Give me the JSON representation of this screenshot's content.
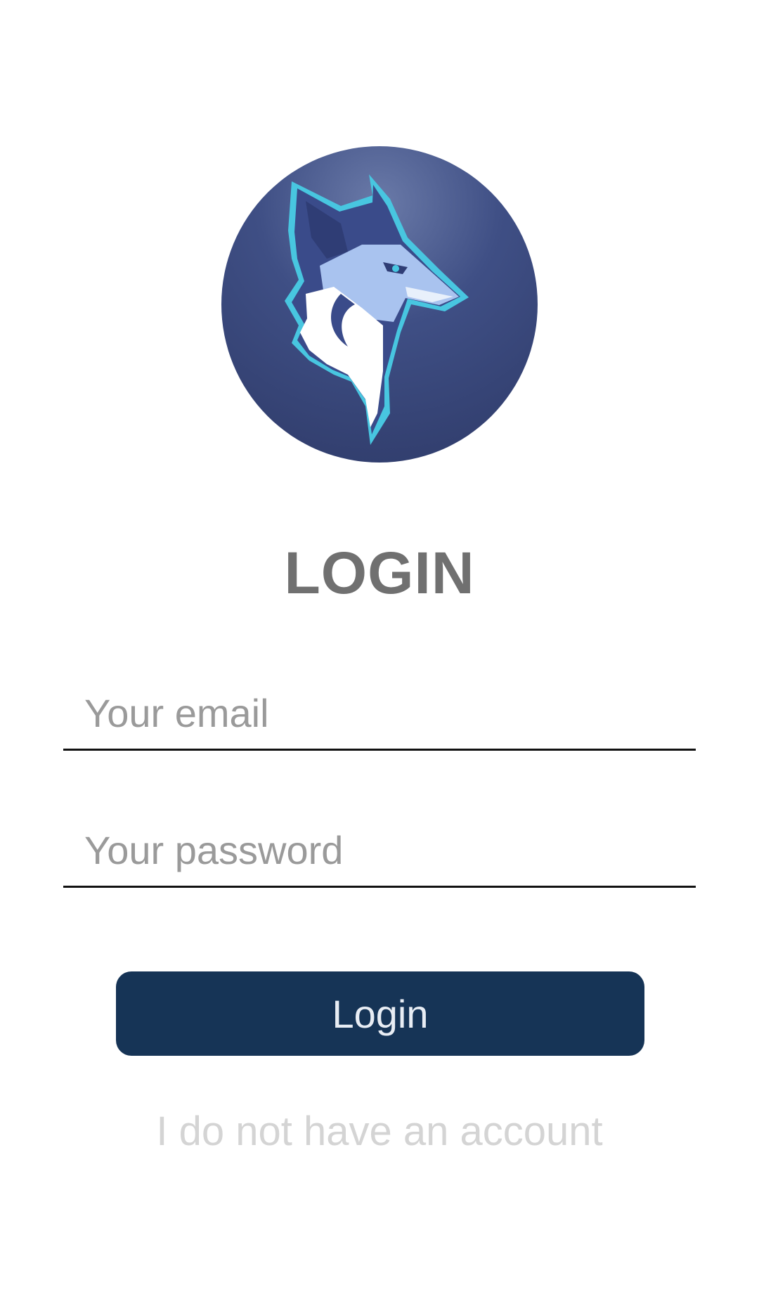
{
  "logo": {
    "icon": "wolf-icon",
    "colors": {
      "background": "#3f4f85",
      "outline": "#48c6e0",
      "fur_light": "#a9c3ef",
      "fur_dark": "#3a4b8a",
      "fur_white": "#ffffff"
    }
  },
  "title": "LOGIN",
  "email": {
    "placeholder": "Your email",
    "value": ""
  },
  "password": {
    "placeholder": "Your password",
    "value": ""
  },
  "login_button": {
    "label": "Login",
    "color": "#163456"
  },
  "no_account_link": "I do not have an account"
}
